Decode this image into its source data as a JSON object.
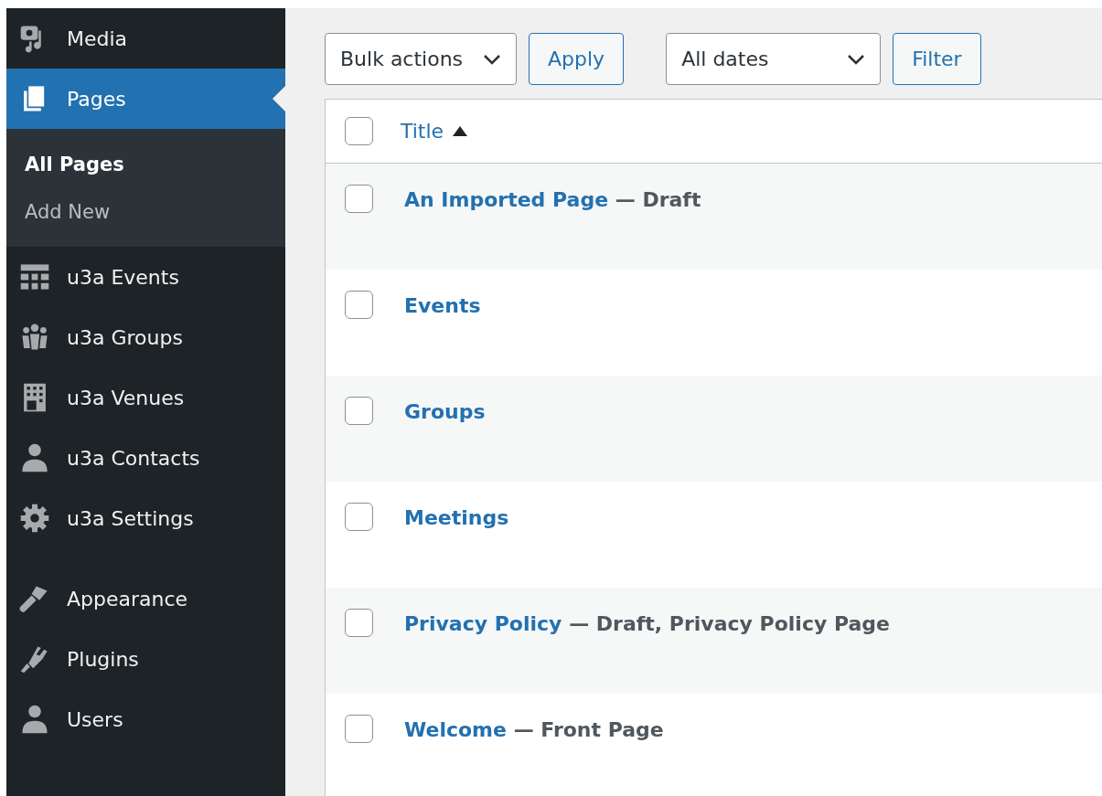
{
  "sidebar": {
    "items": [
      {
        "label": "Media",
        "kind": "media",
        "selected": false
      },
      {
        "label": "Pages",
        "kind": "pages",
        "selected": true,
        "submenu": [
          {
            "label": "All Pages",
            "selected": true
          },
          {
            "label": "Add New",
            "selected": false
          }
        ]
      },
      {
        "label": "u3a Events",
        "kind": "events",
        "selected": false
      },
      {
        "label": "u3a Groups",
        "kind": "groups",
        "selected": false
      },
      {
        "label": "u3a Venues",
        "kind": "venues",
        "selected": false
      },
      {
        "label": "u3a Contacts",
        "kind": "contact",
        "selected": false
      },
      {
        "label": "u3a Settings",
        "kind": "settings",
        "selected": false
      },
      {
        "label": "Appearance",
        "kind": "appearance",
        "selected": false
      },
      {
        "label": "Plugins",
        "kind": "plugins",
        "selected": false
      },
      {
        "label": "Users",
        "kind": "users",
        "selected": false
      }
    ]
  },
  "toolbar": {
    "bulk_actions": "Bulk actions",
    "apply": "Apply",
    "dates": "All dates",
    "filter": "Filter"
  },
  "table": {
    "header": {
      "title": "Title",
      "checked": false
    },
    "rows": [
      {
        "title": "An Imported Page",
        "state": "— Draft",
        "checked": false
      },
      {
        "title": "Events",
        "checked": false
      },
      {
        "title": "Groups",
        "checked": false
      },
      {
        "title": "Meetings",
        "checked": false
      },
      {
        "title": "Privacy Policy",
        "state": "— Draft, Privacy Policy Page",
        "checked": false
      },
      {
        "title": "Welcome",
        "state": "— Front Page",
        "checked": false
      }
    ]
  }
}
